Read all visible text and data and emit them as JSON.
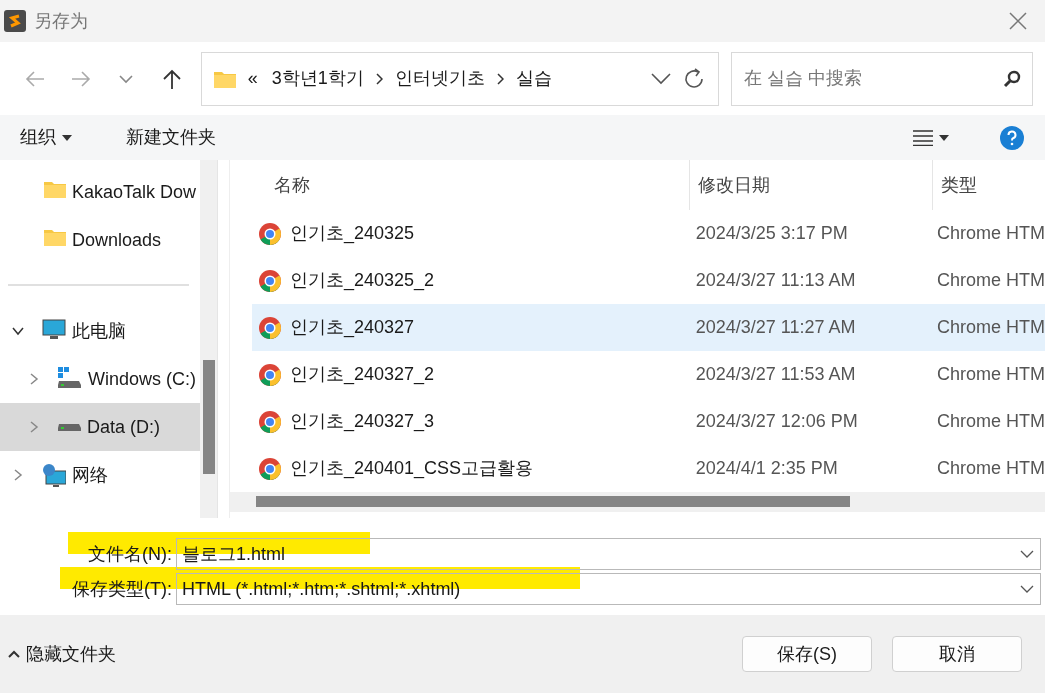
{
  "window": {
    "title": "另存为"
  },
  "address": {
    "overflow": "«",
    "crumbs": [
      "3학년1학기",
      "인터넷기초",
      "실습"
    ]
  },
  "search": {
    "placeholder": "在 실습 中搜索"
  },
  "toolbar": {
    "organize": "组织",
    "new_folder": "新建文件夹"
  },
  "sidebar": {
    "items": [
      {
        "label": "KakaoTalk Dow",
        "kind": "folder",
        "selected": false
      },
      {
        "label": "Downloads",
        "kind": "folder",
        "selected": false
      },
      {
        "kind": "divider"
      },
      {
        "label": "此电脑",
        "kind": "pc",
        "selected": false,
        "expanded": true,
        "children": [
          {
            "label": "Windows (C:)",
            "kind": "sysdrive",
            "selected": false,
            "expanded": false
          },
          {
            "label": "Data (D:)",
            "kind": "drive",
            "selected": true,
            "expanded": false
          }
        ]
      },
      {
        "label": "网络",
        "kind": "network",
        "selected": false,
        "expanded": false
      }
    ]
  },
  "table": {
    "columns": [
      "名称",
      "修改日期",
      "类型"
    ],
    "rows": [
      {
        "name": "인기초_240325",
        "date": "2024/3/25 3:17 PM",
        "type": "Chrome HTM",
        "selected": false
      },
      {
        "name": "인기초_240325_2",
        "date": "2024/3/27 11:13 AM",
        "type": "Chrome HTM",
        "selected": false
      },
      {
        "name": "인기초_240327",
        "date": "2024/3/27 11:27 AM",
        "type": "Chrome HTM",
        "selected": true
      },
      {
        "name": "인기초_240327_2",
        "date": "2024/3/27 11:53 AM",
        "type": "Chrome HTM",
        "selected": false
      },
      {
        "name": "인기초_240327_3",
        "date": "2024/3/27 12:06 PM",
        "type": "Chrome HTM",
        "selected": false
      },
      {
        "name": "인기초_240401_CSS고급활용",
        "date": "2024/4/1 2:35 PM",
        "type": "Chrome HTM",
        "selected": false
      }
    ]
  },
  "fields": [
    {
      "label": "文件名(N):",
      "value": "블로그1.html",
      "highlighted": true
    },
    {
      "label": "保存类型(T):",
      "value": "HTML (*.html;*.htm;*.shtml;*.xhtml)",
      "highlighted": true
    }
  ],
  "footer": {
    "toggle": "隐藏文件夹",
    "buttons": [
      "保存(S)",
      "取消"
    ]
  }
}
